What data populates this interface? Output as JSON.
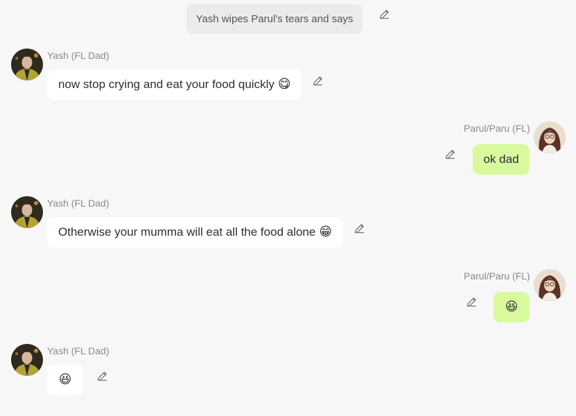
{
  "narration": {
    "text": "Yash wipes Parul's tears and says"
  },
  "messages": [
    {
      "sender": "Yash (FL Dad)",
      "text": "now stop crying and eat your food quickly",
      "emoji": "😋"
    },
    {
      "sender": "Parul/Paru (FL)",
      "text": "ok dad",
      "emoji": ""
    },
    {
      "sender": "Yash (FL Dad)",
      "text": "Otherwise your mumma will eat all the food alone",
      "emoji": "😁"
    },
    {
      "sender": "Parul/Paru (FL)",
      "text": "",
      "emoji": "😆"
    },
    {
      "sender": "Yash (FL Dad)",
      "text": "",
      "emoji": "😆"
    }
  ],
  "icons": {
    "edit": "pencil-icon",
    "avatar_yash": "avatar-yash",
    "avatar_parul": "avatar-parul"
  },
  "colors": {
    "background": "#f7f7f7",
    "incoming_bubble": "#ffffff",
    "outgoing_bubble": "#d9f99d",
    "narration_bubble": "#ebebeb",
    "sender_text": "#8a8a8a"
  }
}
